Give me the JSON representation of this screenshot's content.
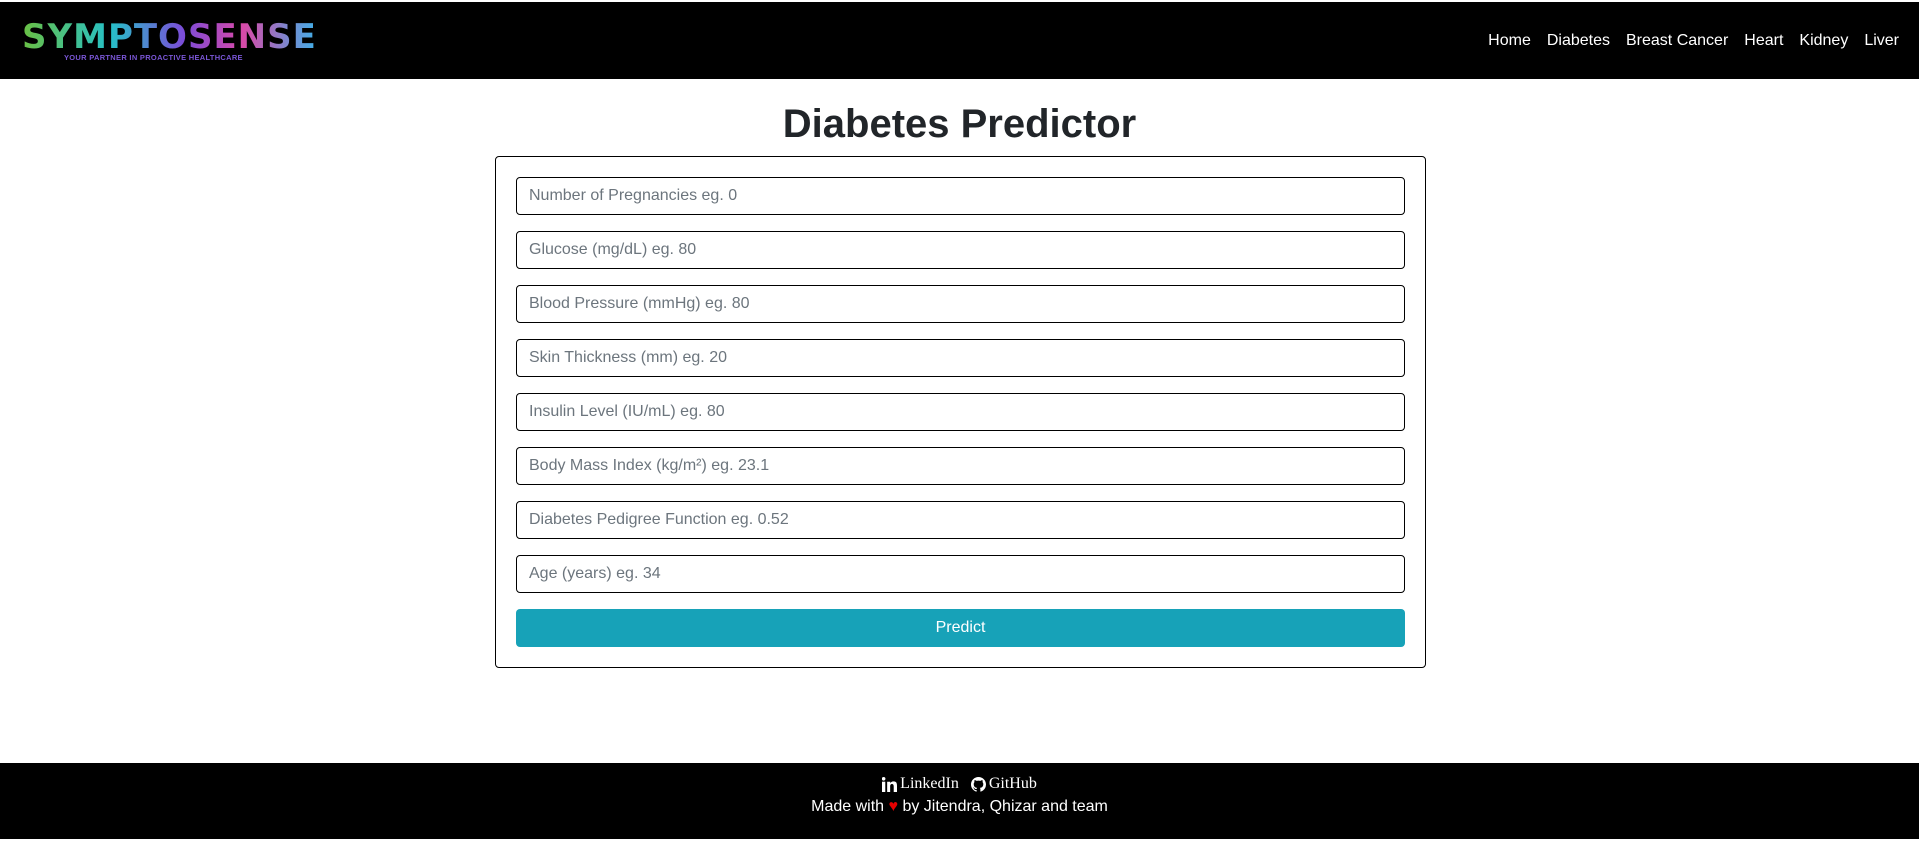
{
  "brand": {
    "name": "SYMPTOSENSE",
    "tagline": "YOUR PARTNER IN PROACTIVE HEALTHCARE"
  },
  "nav": {
    "items": [
      {
        "label": "Home"
      },
      {
        "label": "Diabetes"
      },
      {
        "label": "Breast Cancer"
      },
      {
        "label": "Heart"
      },
      {
        "label": "Kidney"
      },
      {
        "label": "Liver"
      }
    ]
  },
  "page": {
    "title": "Diabetes Predictor"
  },
  "form": {
    "fields": [
      {
        "placeholder": "Number of Pregnancies eg. 0",
        "value": ""
      },
      {
        "placeholder": "Glucose (mg/dL) eg. 80",
        "value": ""
      },
      {
        "placeholder": "Blood Pressure (mmHg) eg. 80",
        "value": ""
      },
      {
        "placeholder": "Skin Thickness (mm) eg. 20",
        "value": ""
      },
      {
        "placeholder": "Insulin Level (IU/mL) eg. 80",
        "value": ""
      },
      {
        "placeholder": "Body Mass Index (kg/m²) eg. 23.1",
        "value": ""
      },
      {
        "placeholder": "Diabetes Pedigree Function eg. 0.52",
        "value": ""
      },
      {
        "placeholder": "Age (years) eg. 34",
        "value": ""
      }
    ],
    "submit_label": "Predict"
  },
  "footer": {
    "linkedin_label": "LinkedIn",
    "linkedin_icon": "linkedin-icon",
    "github_label": "GitHub",
    "github_icon": "github-icon",
    "made_prefix": "Made with",
    "heart": "♥",
    "made_suffix": "by Jitendra, Qhizar and team"
  },
  "colors": {
    "navbar_bg": "#000000",
    "button_bg": "#17a2b8",
    "heart": "#e60000"
  }
}
